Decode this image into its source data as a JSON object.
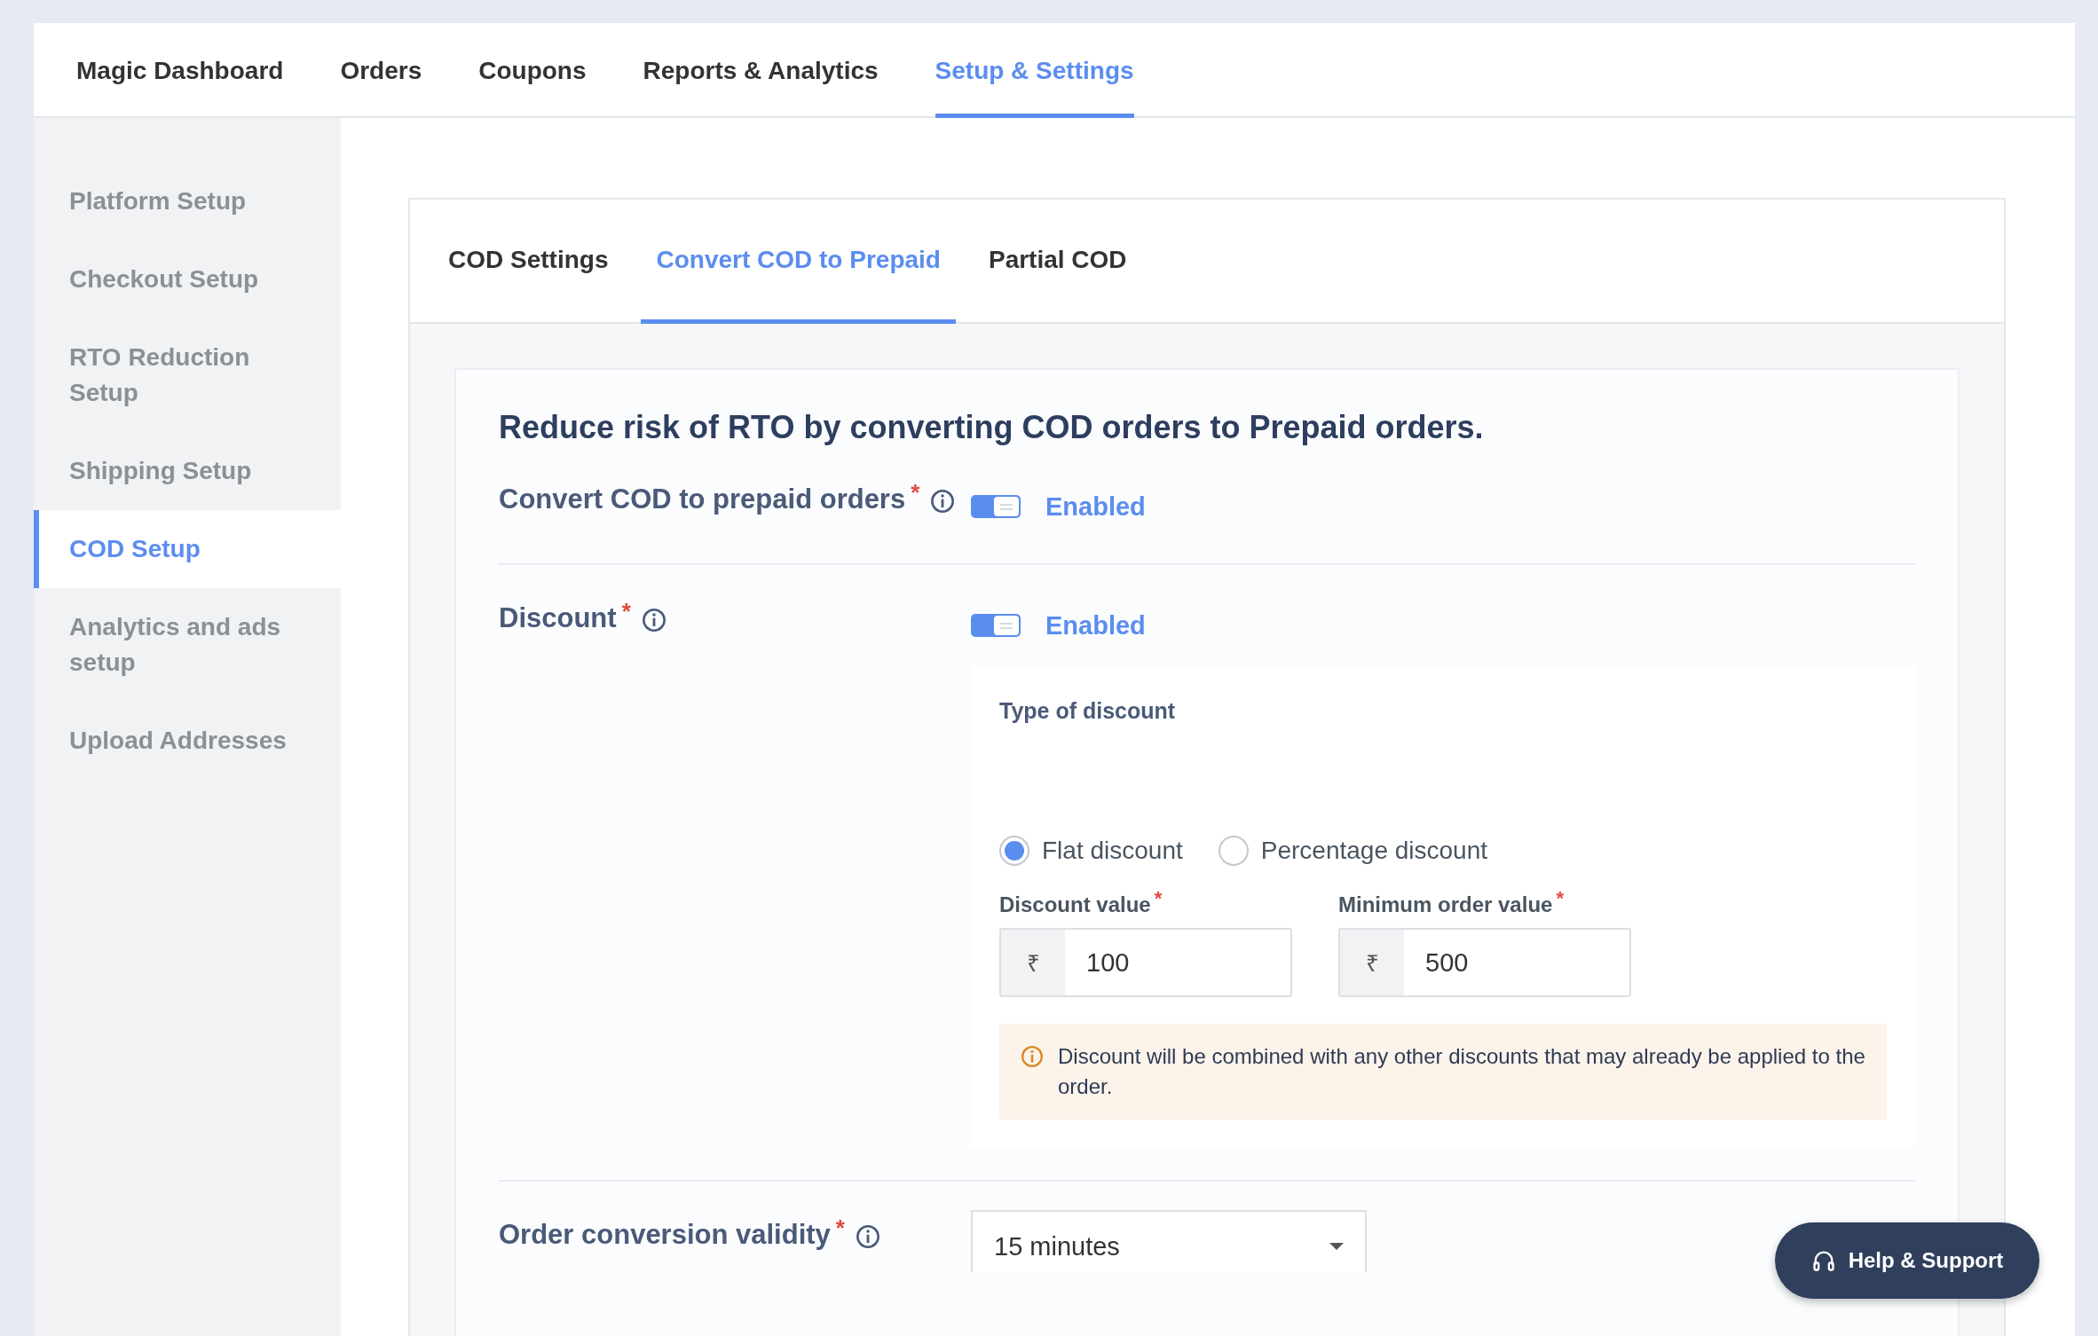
{
  "top_nav": [
    {
      "label": "Magic Dashboard",
      "selected": false
    },
    {
      "label": "Orders",
      "selected": false
    },
    {
      "label": "Coupons",
      "selected": false
    },
    {
      "label": "Reports & Analytics",
      "selected": false
    },
    {
      "label": "Setup & Settings",
      "selected": true
    }
  ],
  "sidebar": {
    "items": [
      {
        "label": "Platform Setup",
        "selected": false
      },
      {
        "label": "Checkout Setup",
        "selected": false
      },
      {
        "label": "RTO Reduction Setup",
        "selected": false
      },
      {
        "label": "Shipping Setup",
        "selected": false
      },
      {
        "label": "COD Setup",
        "selected": true
      },
      {
        "label": "Analytics and ads setup",
        "selected": false
      },
      {
        "label": "Upload Addresses",
        "selected": false
      }
    ]
  },
  "sub_tabs": [
    {
      "label": "COD Settings",
      "selected": false
    },
    {
      "label": "Convert COD to Prepaid",
      "selected": true
    },
    {
      "label": "Partial COD",
      "selected": false
    }
  ],
  "panel": {
    "heading": "Reduce risk of RTO by converting COD orders to Prepaid orders.",
    "settings": [
      {
        "kind": "toggle",
        "label": "Convert COD to prepaid orders",
        "required_mark": "*",
        "on": true,
        "state_label": "Enabled"
      },
      {
        "kind": "toggle",
        "label": "Discount",
        "required_mark": "*",
        "on": true,
        "state_label": "Enabled",
        "discount": {
          "type_label": "Type of discount",
          "options": [
            {
              "label": "Flat discount",
              "selected": true
            },
            {
              "label": "Percentage discount",
              "selected": false
            }
          ],
          "fields": [
            {
              "label": "Discount value",
              "required_mark": "*",
              "prefix": "₹",
              "value": "100"
            },
            {
              "label": "Minimum order value",
              "required_mark": "*",
              "prefix": "₹",
              "value": "500"
            }
          ],
          "notice": "Discount will be combined with any other discounts that may already be applied to the order."
        }
      },
      {
        "kind": "select",
        "label": "Order conversion validity",
        "required_mark": "*",
        "value": "15 minutes"
      }
    ]
  },
  "help_button": {
    "label": "Help & Support"
  }
}
